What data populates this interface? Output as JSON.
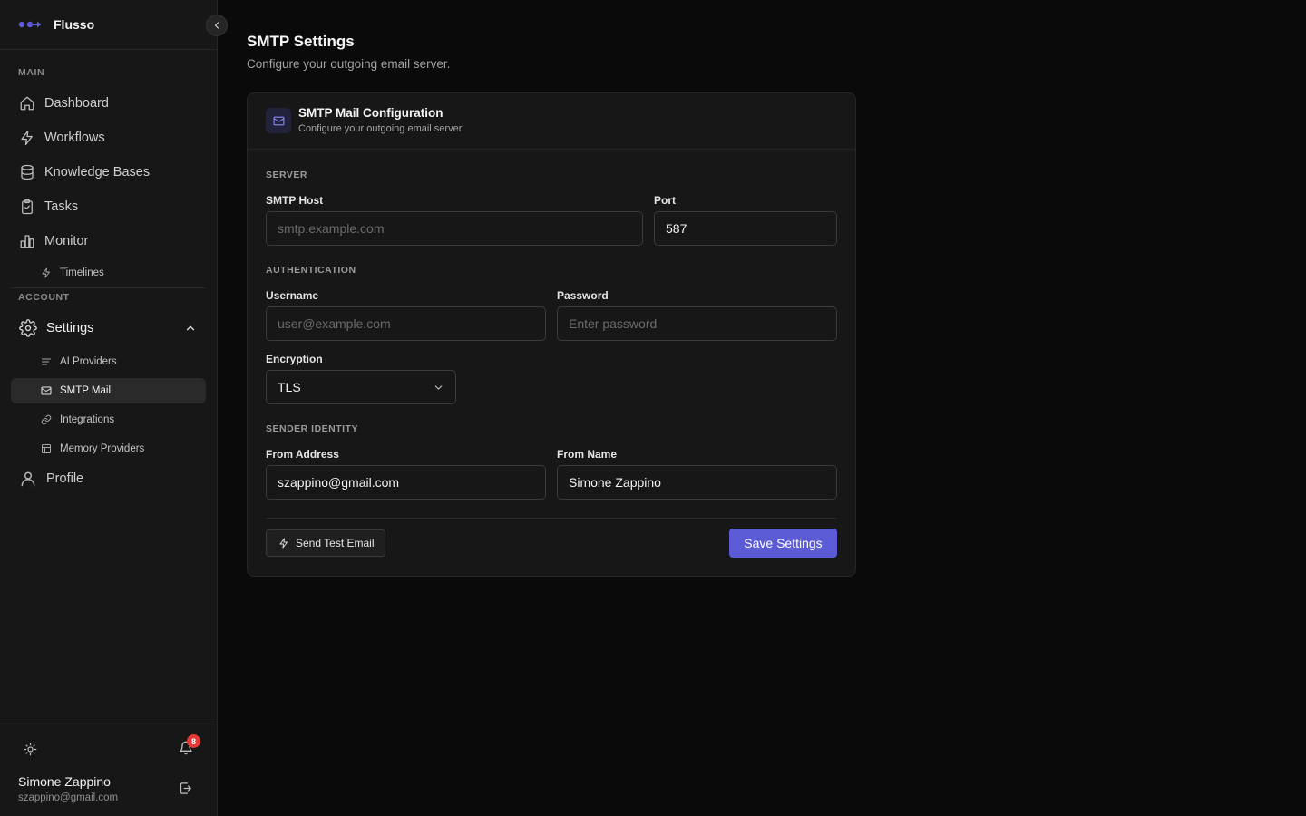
{
  "brand": {
    "name": "Flusso",
    "accent": "#5b5bd6"
  },
  "sidebar": {
    "main_label": "MAIN",
    "account_label": "ACCOUNT",
    "items": {
      "dashboard": "Dashboard",
      "workflows": "Workflows",
      "knowledge_bases": "Knowledge Bases",
      "tasks": "Tasks",
      "monitor": "Monitor",
      "timelines": "Timelines",
      "settings": "Settings",
      "ai_providers": "AI Providers",
      "smtp_mail": "SMTP Mail",
      "integrations": "Integrations",
      "memory_providers": "Memory Providers",
      "profile": "Profile"
    },
    "active_item": "SMTP Mail",
    "notifications_count": "8",
    "user": {
      "name": "Simone Zappino",
      "email": "szappino@gmail.com"
    }
  },
  "page": {
    "title": "SMTP Settings",
    "subtitle": "Configure your outgoing email server."
  },
  "card": {
    "title": "SMTP Mail Configuration",
    "description": "Configure your outgoing email server",
    "server_label": "SERVER",
    "host": {
      "label": "SMTP Host",
      "value": "",
      "placeholder": "smtp.example.com"
    },
    "port": {
      "label": "Port",
      "value": "587"
    },
    "auth_label": "AUTHENTICATION",
    "username": {
      "label": "Username",
      "value": "",
      "placeholder": "user@example.com"
    },
    "password": {
      "label": "Password",
      "value": "",
      "placeholder": "Enter password"
    },
    "encryption": {
      "label": "Encryption",
      "value": "TLS"
    },
    "sender_label": "SENDER IDENTITY",
    "from_address": {
      "label": "From Address",
      "value": "szappino@gmail.com"
    },
    "from_name": {
      "label": "From Name",
      "value": "Simone Zappino"
    },
    "test_button": "Send Test Email",
    "save_button": "Save Settings"
  }
}
